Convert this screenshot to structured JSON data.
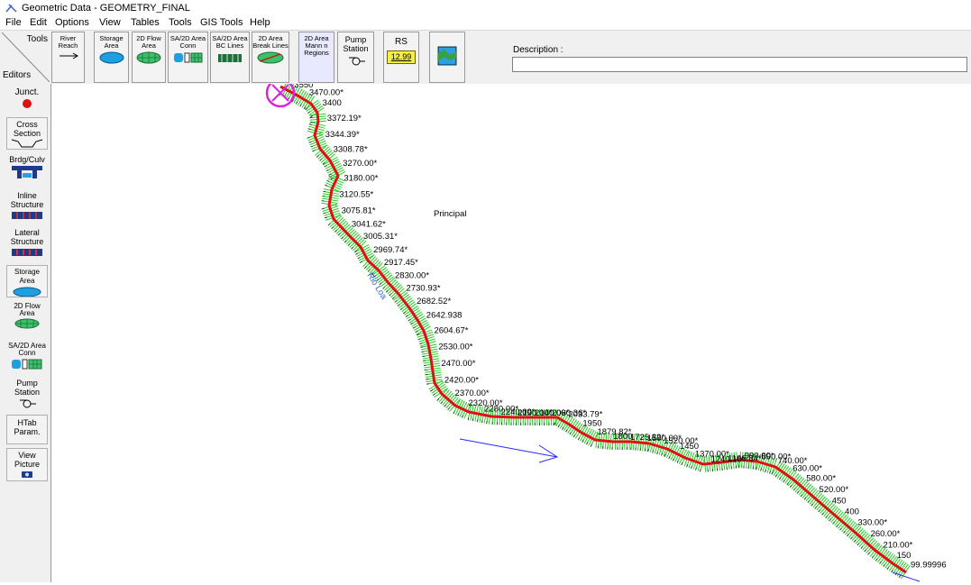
{
  "window": {
    "title": "Geometric Data - GEOMETRY_FINAL"
  },
  "menu": [
    "File",
    "Edit",
    "Options",
    "View",
    "Tables",
    "Tools",
    "GIS Tools",
    "Help"
  ],
  "toolbar": {
    "tools_label": "Tools",
    "editors_label": "Editors",
    "buttons": [
      {
        "label": "River Reach"
      },
      {
        "label": "Storage Area"
      },
      {
        "label": "2D Flow Area"
      },
      {
        "label": "SA/2D Area Conn"
      },
      {
        "label": "SA/2D Area BC Lines"
      },
      {
        "label": "2D Area Break Lines"
      },
      {
        "label": "2D Area Mann n Regions"
      },
      {
        "label": "Pump Station"
      },
      {
        "label": "RS",
        "value": "12.99"
      },
      {
        "label": "",
        "icon": "map-picture-icon"
      }
    ],
    "description_label": "Description :",
    "description_value": ""
  },
  "editors": [
    {
      "label": "Junct."
    },
    {
      "label": "Cross Section"
    },
    {
      "label": "Brdg/Culv"
    },
    {
      "label": "Inline Structure"
    },
    {
      "label": "Lateral Structure"
    },
    {
      "label": "Storage Area"
    },
    {
      "label": "2D Flow Area"
    },
    {
      "label": "SA/2D Area Conn"
    },
    {
      "label": "Pump Station"
    },
    {
      "label": "HTab Param."
    },
    {
      "label": "View Picture"
    }
  ],
  "map": {
    "reach_label": "Principal",
    "river_label": "Rio Loa",
    "colors": {
      "reach": "#e01010",
      "xs": "#22cc22",
      "flow_arrow": "#2a2aff",
      "junction_marker": "#e020e0"
    },
    "cross_sections": [
      "3550",
      "3470.00*",
      "3400",
      "3372.19*",
      "3344.39*",
      "3308.78*",
      "3270.00*",
      "3180.00*",
      "3120.55*",
      "3075.81*",
      "3041.62*",
      "3005.31*",
      "2969.74*",
      "2917.45*",
      "2830.00*",
      "2730.93*",
      "2682.52*",
      "2642.938",
      "2604.67*",
      "2530.00*",
      "2470.00*",
      "2420.00*",
      "2370.00*",
      "2320.00*",
      "2280.00*",
      "2240.00*",
      "2190.00*",
      "2140.06*",
      "2090.36*",
      "2033.79*",
      "1950",
      "1879.82*",
      "1800",
      "1725.32*",
      "1590.00*",
      "1520.00*",
      "1450",
      "1370.00*",
      "1240.10*",
      "1166.84*",
      "990.00*",
      "890.00*",
      "740.00*",
      "630.00*",
      "580.00*",
      "520.00*",
      "450",
      "400",
      "330.00*",
      "260.00*",
      "210.00*",
      "150",
      "99.99996"
    ]
  }
}
